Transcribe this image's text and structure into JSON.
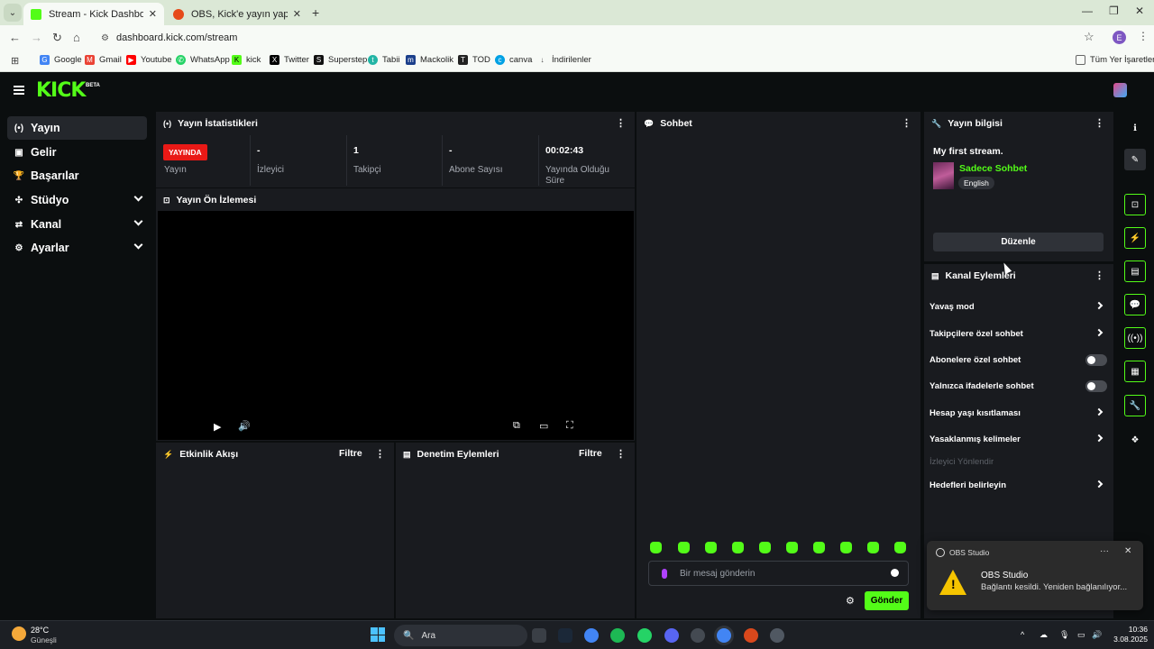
{
  "browser": {
    "tabs": [
      {
        "title": "Stream - Kick Dashboard",
        "favicon_color": "#53fc18",
        "active": true
      },
      {
        "title": "OBS, Kick'e yayın yaparken süre",
        "favicon_color": "#e64a19",
        "active": false
      }
    ],
    "url": "dashboard.kick.com/stream",
    "profile_initial": "E",
    "bookmarks": [
      {
        "label": "Google",
        "icon_color": "#4285f4",
        "icon": "G"
      },
      {
        "label": "Gmail",
        "icon_color": "#ea4335",
        "icon": "M"
      },
      {
        "label": "Youtube",
        "icon_color": "#ff0000",
        "icon": "▶"
      },
      {
        "label": "WhatsApp",
        "icon_color": "#25d366",
        "icon": "✆"
      },
      {
        "label": "kick",
        "icon_color": "#53fc18",
        "icon": "K"
      },
      {
        "label": "Twitter",
        "icon_color": "#000000",
        "icon": "X"
      },
      {
        "label": "Superstep",
        "icon_color": "#111111",
        "icon": "S"
      },
      {
        "label": "Tabii",
        "icon_color": "#22b5a5",
        "icon": "t"
      },
      {
        "label": "Mackolik",
        "icon_color": "#1b3f8b",
        "icon": "m"
      },
      {
        "label": "TOD",
        "icon_color": "#222222",
        "icon": "T"
      },
      {
        "label": "canva",
        "icon_color": "#00a1e4",
        "icon": "c"
      },
      {
        "label": "İndirilenler",
        "icon_color": "#555555",
        "icon": "↓"
      }
    ],
    "all_bookmarks": "Tüm Yer İşaretleri"
  },
  "kick": {
    "logo": "KICK",
    "logo_beta": "BETA",
    "brand_color": "#53fc18",
    "sidebar": [
      {
        "label": "Yayın",
        "icon": "broadcast-icon",
        "active": true,
        "expandable": false
      },
      {
        "label": "Gelir",
        "icon": "revenue-icon",
        "active": false,
        "expandable": false
      },
      {
        "label": "Başarılar",
        "icon": "trophy-icon",
        "active": false,
        "expandable": false
      },
      {
        "label": "Stüdyo",
        "icon": "studio-icon",
        "active": false,
        "expandable": true
      },
      {
        "label": "Kanal",
        "icon": "channel-icon",
        "active": false,
        "expandable": true
      },
      {
        "label": "Ayarlar",
        "icon": "settings-icon",
        "active": false,
        "expandable": true
      }
    ],
    "stats_panel": {
      "title": "Yayın İstatistikleri",
      "live_badge": "YAYINDA",
      "items": [
        {
          "value": "",
          "label": "Yayın"
        },
        {
          "value": "-",
          "label": "İzleyici"
        },
        {
          "value": "1",
          "label": "Takipçi"
        },
        {
          "value": "-",
          "label": "Abone Sayısı"
        },
        {
          "value": "00:02:43",
          "label": "Yayında Olduğu Süre"
        }
      ]
    },
    "preview_panel": {
      "title": "Yayın Ön İzlemesi"
    },
    "activity_panel": {
      "title": "Etkinlik Akışı",
      "filter": "Filtre"
    },
    "moderation_panel": {
      "title": "Denetim Eylemleri",
      "filter": "Filtre"
    },
    "chat_panel": {
      "title": "Sohbet",
      "input_placeholder": "Bir mesaj gönderin",
      "send_label": "Gönder"
    },
    "stream_info": {
      "title": "Yayın bilgisi",
      "stream_title": "My first stream.",
      "category": "Sadece Sohbet",
      "language": "English",
      "edit_label": "Düzenle"
    },
    "channel_actions": {
      "title": "Kanal Eylemleri",
      "items": [
        {
          "label": "Yavaş mod",
          "control": "chevron"
        },
        {
          "label": "Takipçilere özel sohbet",
          "control": "chevron"
        },
        {
          "label": "Abonelere özel sohbet",
          "control": "toggle"
        },
        {
          "label": "Yalnızca ifadelerle sohbet",
          "control": "toggle"
        },
        {
          "label": "Hesap yaşı kısıtlaması",
          "control": "chevron"
        },
        {
          "label": "Yasaklanmış kelimeler",
          "control": "chevron"
        },
        {
          "label": "İzleyici Yönlendir",
          "control": "disabled"
        },
        {
          "label": "Hedefleri belirleyin",
          "control": "chevron"
        }
      ]
    }
  },
  "notification": {
    "app": "OBS Studio",
    "title": "OBS Studio",
    "body": "Bağlantı kesildi. Yeniden bağlanılıyor..."
  },
  "taskbar": {
    "temperature": "28°C",
    "weather": "Güneşli",
    "search_placeholder": "Ara",
    "time": "10:36",
    "date": "3.08.2025"
  }
}
